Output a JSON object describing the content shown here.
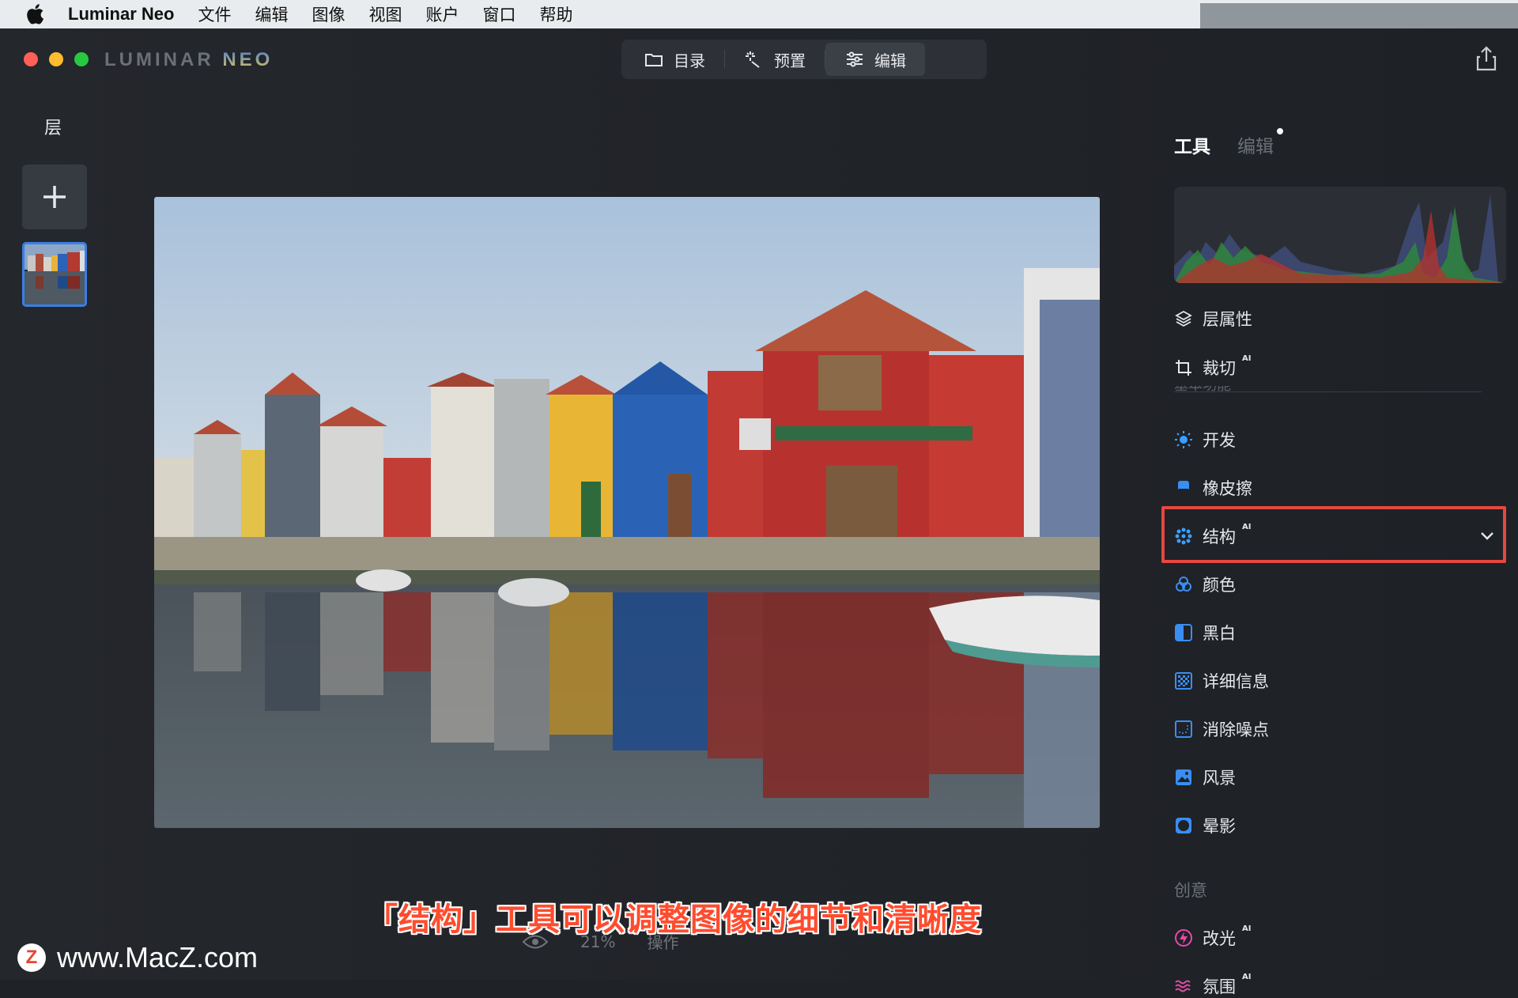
{
  "menubar": {
    "app_name": "Luminar Neo",
    "items": [
      "文件",
      "编辑",
      "图像",
      "视图",
      "账户",
      "窗口",
      "帮助"
    ]
  },
  "window": {
    "logo_main": "LUMINAR",
    "logo_accent": "NEO",
    "tabs": [
      {
        "label": "目录",
        "icon": "folder-icon"
      },
      {
        "label": "预置",
        "icon": "magic-wand-icon"
      },
      {
        "label": "编辑",
        "icon": "sliders-icon"
      }
    ],
    "active_tab": "编辑"
  },
  "layers": {
    "title": "层"
  },
  "panel": {
    "tab_tools": "工具",
    "tab_edits": "编辑",
    "tools": [
      {
        "label": "层属性",
        "icon": "layers-icon",
        "ai": false
      },
      {
        "label": "裁切",
        "icon": "crop-icon",
        "ai": true
      }
    ],
    "faded_section": "基本功能",
    "essentials": [
      {
        "label": "开发",
        "icon": "develop-icon",
        "ai": false
      },
      {
        "label": "橡皮擦",
        "icon": "eraser-icon",
        "ai": false
      },
      {
        "label": "结构",
        "icon": "structure-icon",
        "ai": true
      },
      {
        "label": "颜色",
        "icon": "color-icon",
        "ai": false
      },
      {
        "label": "黑白",
        "icon": "black-white-icon",
        "ai": false
      },
      {
        "label": "详细信息",
        "icon": "details-icon",
        "ai": false
      },
      {
        "label": "消除噪点",
        "icon": "denoise-icon",
        "ai": false
      },
      {
        "label": "风景",
        "icon": "landscape-icon",
        "ai": false
      },
      {
        "label": "晕影",
        "icon": "vignette-icon",
        "ai": false
      }
    ],
    "creative_title": "创意",
    "creative": [
      {
        "label": "改光",
        "icon": "relight-icon",
        "ai": true
      },
      {
        "label": "氛围",
        "icon": "atmosphere-icon",
        "ai": true
      }
    ],
    "ai_tag": "AI"
  },
  "bottom": {
    "zoom": "21%",
    "actions": "操作"
  },
  "caption": "「结构」工具可以调整图像的细节和清晰度",
  "watermark": {
    "badge": "Z",
    "text": "www.MacZ.com"
  },
  "colors": {
    "accent_blue": "#3a7fe6",
    "highlight_red": "#e6473f",
    "caption_red": "#ff4c2e"
  }
}
